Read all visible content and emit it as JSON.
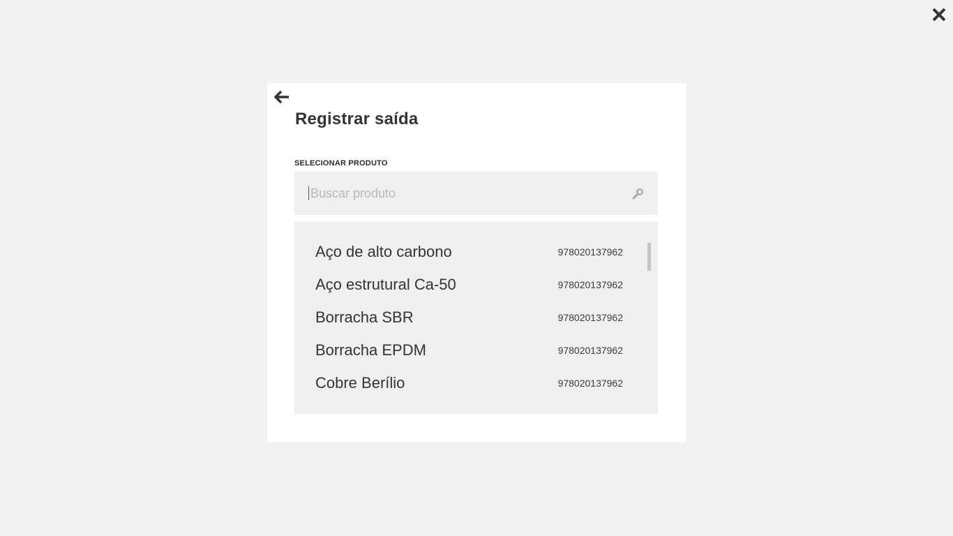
{
  "header": {
    "close_icon": "close-icon"
  },
  "modal": {
    "back_icon": "arrow-left-icon",
    "title": "Registrar saída",
    "field_label": "SELECIONAR PRODUTO",
    "search": {
      "placeholder": "Buscar produto",
      "value": "",
      "icon": "search-icon"
    },
    "products": [
      {
        "name": "Aço de alto carbono",
        "code": "978020137962"
      },
      {
        "name": "Aço estrutural Ca-50",
        "code": "978020137962"
      },
      {
        "name": "Borracha SBR",
        "code": "978020137962"
      },
      {
        "name": "Borracha EPDM",
        "code": "978020137962"
      },
      {
        "name": "Cobre Berílio",
        "code": "978020137962"
      }
    ]
  }
}
